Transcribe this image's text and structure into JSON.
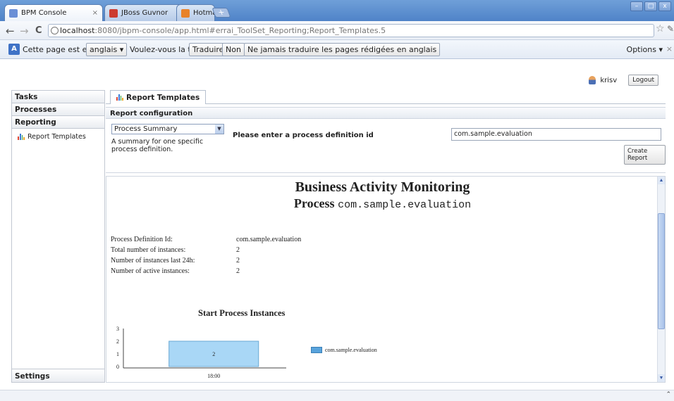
{
  "browser": {
    "tabs": [
      {
        "title": "BPM Console",
        "close": "×",
        "fav_color": "#6b8fd6"
      },
      {
        "title": "JBoss Guvnor",
        "close": "×",
        "fav_color": "#cc3b2f"
      },
      {
        "title": "Hotmail - brian_cose@hotmail",
        "close": "×",
        "fav_color": "#e8822a"
      }
    ],
    "newtab": "+",
    "window_controls": [
      "–",
      "□",
      "x"
    ],
    "nav": {
      "back": "←",
      "forward": "→",
      "reload": "C"
    },
    "url_host": "localhost",
    "url_path": ":8080/jbpm-console/app.html#errai_ToolSet_Reporting;Report_Templates.5",
    "star": "☆",
    "wrench": "🔧"
  },
  "translate": {
    "icon_text": "A",
    "prefix": "Cette page est en",
    "language": "anglais ▾",
    "question": "Voulez-vous la traduire ?",
    "translate_btn": "Traduire",
    "no_btn": "Non",
    "never_btn": "Ne jamais traduire les pages rédigées en anglais",
    "options": "Options ▾",
    "close": "×"
  },
  "user": {
    "name": "krisv",
    "logout": "Logout"
  },
  "nav": {
    "tasks": "Tasks",
    "processes": "Processes",
    "reporting": "Reporting",
    "report_templates": "Report Templates",
    "settings": "Settings"
  },
  "main": {
    "tab": "Report Templates",
    "config_header": "Report configuration",
    "template_select": "Process Summary",
    "template_desc": "A summary for one specific process definition.",
    "pd_label": "Please enter a process definition id",
    "pd_value": "com.sample.evaluation",
    "create_button": "Create Report"
  },
  "report": {
    "title": "Business Activity Monitoring",
    "sub_prefix": "Process ",
    "sub_id": "com.sample.evaluation",
    "stats": [
      {
        "k": "Process Definition Id:",
        "v": "com.sample.evaluation"
      },
      {
        "k": "Total number of instances:",
        "v": "2"
      },
      {
        "k": "Number of instances last 24h:",
        "v": "2"
      },
      {
        "k": "Number of active instances:",
        "v": "2"
      }
    ]
  },
  "chart_data": {
    "type": "bar",
    "title": "Start Process Instances",
    "categories": [
      "18:00"
    ],
    "series": [
      {
        "name": "com.sample.evaluation",
        "values": [
          2
        ]
      }
    ],
    "ylim": [
      0,
      3
    ],
    "yticks": [
      0,
      1,
      2,
      3
    ],
    "data_labels": true,
    "legend": "right",
    "bar_color": "#a9d7f6"
  }
}
